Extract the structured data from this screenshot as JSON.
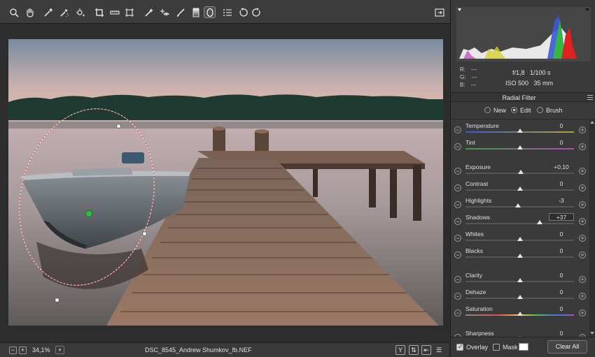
{
  "toolbar": {
    "tools": [
      "zoom-icon",
      "hand-icon",
      "white-balance-icon",
      "color-sampler-icon",
      "targeted-adjustment-icon",
      "crop-icon",
      "straighten-icon",
      "transform-icon",
      "spot-removal-icon",
      "red-eye-icon",
      "adjustment-brush-icon",
      "graduated-filter-icon",
      "radial-filter-icon",
      "list-icon",
      "rotate-left-icon",
      "rotate-right-icon"
    ],
    "active_tool": "radial-filter-icon",
    "right_icon": "toggle-fullscreen-icon"
  },
  "image": {
    "filename": "DSC_8545_Andrew Shumkov_fb.NEF",
    "zoom": "34,1%"
  },
  "meta": {
    "r_label": "R:",
    "r_value": "---",
    "g_label": "G:",
    "g_value": "---",
    "b_label": "B:",
    "b_value": "---",
    "aperture_shutter": "f/1,8   1/100 s",
    "iso_focal": "ISO 500   35 mm"
  },
  "panel": {
    "title": "Radial Filter",
    "modes": [
      {
        "label": "New",
        "selected": false
      },
      {
        "label": "Edit",
        "selected": true
      },
      {
        "label": "Brush",
        "selected": false
      }
    ],
    "sliders": [
      {
        "label": "Temperature",
        "value": "0",
        "pos": 0.5,
        "track": "temp"
      },
      {
        "label": "Tint",
        "value": "0",
        "pos": 0.5,
        "track": "tint"
      },
      {
        "label": "Exposure",
        "value": "+0,10",
        "pos": 0.51,
        "track": "plain"
      },
      {
        "label": "Contrast",
        "value": "0",
        "pos": 0.5,
        "track": "plain"
      },
      {
        "label": "Highlights",
        "value": "-3",
        "pos": 0.485,
        "track": "plain"
      },
      {
        "label": "Shadows",
        "value": "+37",
        "pos": 0.685,
        "track": "plain"
      },
      {
        "label": "Whites",
        "value": "0",
        "pos": 0.5,
        "track": "plain"
      },
      {
        "label": "Blacks",
        "value": "0",
        "pos": 0.5,
        "track": "plain"
      },
      {
        "label": "Clarity",
        "value": "0",
        "pos": 0.5,
        "track": "plain"
      },
      {
        "label": "Dehaze",
        "value": "0",
        "pos": 0.5,
        "track": "plain"
      },
      {
        "label": "Saturation",
        "value": "0",
        "pos": 0.5,
        "track": "sat"
      },
      {
        "label": "Sharpness",
        "value": "0",
        "pos": 0.5,
        "track": "plain"
      }
    ]
  },
  "footer": {
    "overlay_label": "Overlay",
    "overlay_checked": true,
    "mask_label": "Mask",
    "mask_checked": false,
    "mask_color": "#ffffff",
    "clear_all_label": "Clear All"
  }
}
